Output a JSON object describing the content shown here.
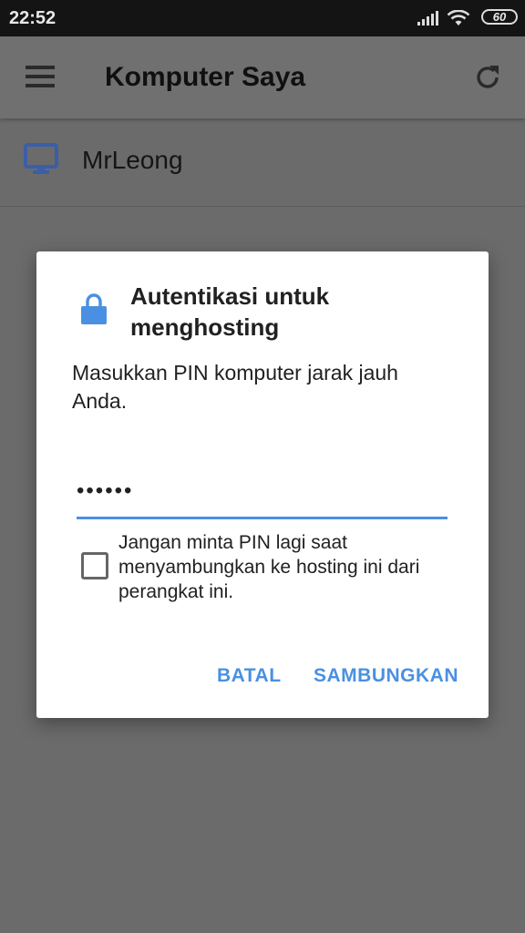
{
  "status_bar": {
    "time": "22:52",
    "battery_level": "60"
  },
  "app_bar": {
    "title": "Komputer Saya",
    "icons": [
      "menu-icon",
      "refresh-icon"
    ]
  },
  "host_list": [
    {
      "name": "MrLeong",
      "icon": "monitor-icon"
    }
  ],
  "dialog": {
    "icon": "lock-icon",
    "title": "Autentikasi untuk menghosting",
    "message": "Masukkan PIN komputer jarak jauh Anda.",
    "pin_value": "••••••",
    "remember_label": "Jangan minta PIN lagi saat menyambungkan ke hosting ini dari perangkat ini.",
    "remember_checked": false,
    "cancel_label": "BATAL",
    "connect_label": "SAMBUNGKAN"
  },
  "colors": {
    "accent": "#4a90e2",
    "monitor_icon": "#3b5ea8",
    "overlay_background": "#6b6b6b",
    "status_bar": "#141414"
  }
}
